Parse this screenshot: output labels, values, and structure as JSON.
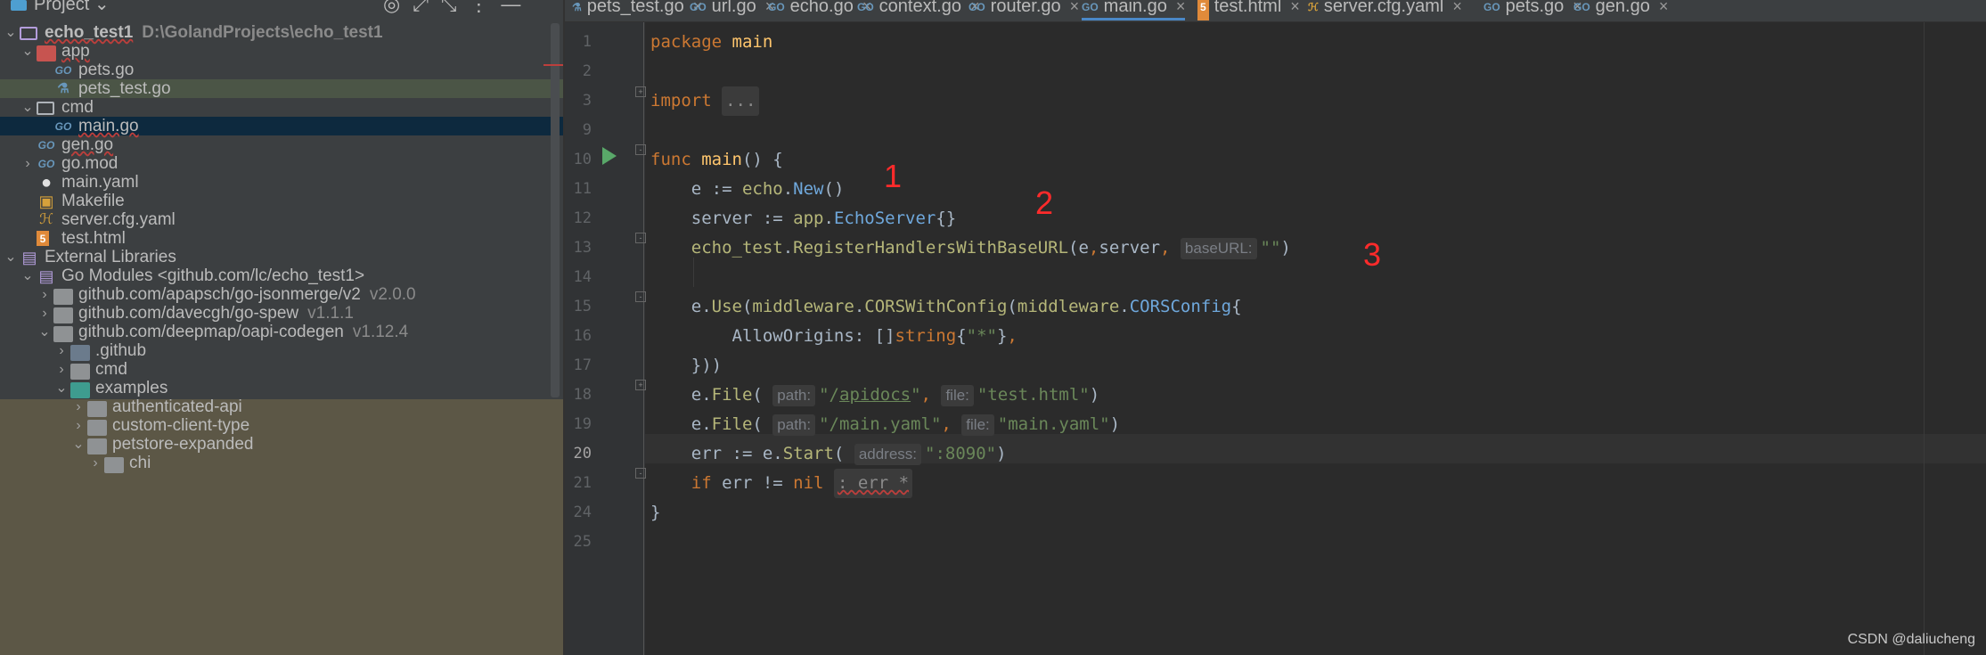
{
  "sidebar": {
    "title": "Project",
    "tree": [
      {
        "label": "echo_test1",
        "extra": "D:\\GolandProjects\\echo_test1",
        "type": "module",
        "depth": 0,
        "arrow": "open"
      },
      {
        "label": "app",
        "type": "folder-pkg",
        "depth": 1,
        "arrow": "open"
      },
      {
        "label": "pets.go",
        "type": "go",
        "depth": 2
      },
      {
        "label": "pets_test.go",
        "type": "gotest",
        "depth": 2,
        "highlight": true
      },
      {
        "label": "cmd",
        "type": "folder-outline",
        "depth": 1,
        "arrow": "open"
      },
      {
        "label": "main.go",
        "type": "go",
        "depth": 2,
        "selected": true
      },
      {
        "label": "gen.go",
        "type": "go",
        "depth": 1
      },
      {
        "label": "go.mod",
        "type": "go",
        "depth": 1,
        "arrow": "closed"
      },
      {
        "label": "main.yaml",
        "type": "github",
        "depth": 1
      },
      {
        "label": "Makefile",
        "type": "make",
        "depth": 1
      },
      {
        "label": "server.cfg.yaml",
        "type": "yaml",
        "depth": 1
      },
      {
        "label": "test.html",
        "type": "html",
        "depth": 1
      },
      {
        "label": "External Libraries",
        "type": "lib",
        "depth": 0,
        "arrow": "open"
      },
      {
        "label": "Go Modules <github.com/lc/echo_test1>",
        "type": "lib",
        "depth": 1,
        "arrow": "open"
      },
      {
        "label": "github.com/apapsch/go-jsonmerge/v2",
        "extra": "v2.0.0",
        "type": "folder",
        "depth": 2,
        "arrow": "closed"
      },
      {
        "label": "github.com/davecgh/go-spew",
        "extra": "v1.1.1",
        "type": "folder",
        "depth": 2,
        "arrow": "closed"
      },
      {
        "label": "github.com/deepmap/oapi-codegen",
        "extra": "v1.12.4",
        "type": "folder",
        "depth": 2,
        "arrow": "open"
      },
      {
        "label": ".github",
        "type": "github-folder",
        "depth": 3,
        "arrow": "closed"
      },
      {
        "label": "cmd",
        "type": "folder",
        "depth": 3,
        "arrow": "closed"
      },
      {
        "label": "examples",
        "type": "folder-teal",
        "depth": 3,
        "arrow": "open"
      },
      {
        "label": "authenticated-api",
        "type": "folder",
        "depth": 4,
        "arrow": "closed"
      },
      {
        "label": "custom-client-type",
        "type": "folder",
        "depth": 4,
        "arrow": "closed"
      },
      {
        "label": "petstore-expanded",
        "type": "folder",
        "depth": 4,
        "arrow": "open"
      },
      {
        "label": "chi",
        "type": "folder",
        "depth": 5,
        "arrow": "closed"
      }
    ]
  },
  "tabs": [
    {
      "label": "pets_test.go",
      "icon": "gotest-icon"
    },
    {
      "label": "url.go",
      "icon": "go-icon"
    },
    {
      "label": "echo.go",
      "icon": "go-icon"
    },
    {
      "label": "context.go",
      "icon": "go-icon"
    },
    {
      "label": "router.go",
      "icon": "go-icon"
    },
    {
      "label": "main.go",
      "icon": "go-icon",
      "active": true
    },
    {
      "label": "test.html",
      "icon": "html-icon"
    },
    {
      "label": "server.cfg.yaml",
      "icon": "yaml-icon"
    },
    {
      "label": "pets.go",
      "icon": "go-icon"
    },
    {
      "label": "gen.go",
      "icon": "go-icon"
    }
  ],
  "editor": {
    "line_numbers": [
      "1",
      "2",
      "3",
      "9",
      "10",
      "11",
      "12",
      "13",
      "14",
      "15",
      "16",
      "17",
      "18",
      "19",
      "20",
      "21",
      "24",
      "25"
    ],
    "current_line": "20",
    "hints": {
      "baseURL": "baseURL:",
      "path": "path:",
      "file": "file:",
      "address": "address:"
    },
    "annotations": [
      "1",
      "2",
      "3"
    ]
  },
  "watermark": "CSDN @daliucheng",
  "colors": {
    "keyword": "#cc7832",
    "function": "#ffc66d",
    "string": "#6a8759",
    "selection": "#0d293e",
    "annotation": "#ff2b2b"
  }
}
